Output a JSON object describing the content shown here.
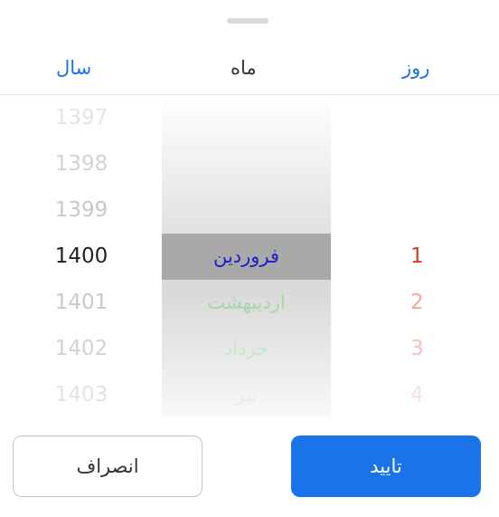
{
  "header": {
    "year_label": "سال",
    "month_label": "ماه",
    "day_label": "روز"
  },
  "years": [
    "1397",
    "1398",
    "1399",
    "1400",
    "1401",
    "1402",
    "1403"
  ],
  "months": [
    {
      "label": "فروردین",
      "row": 3,
      "color": "#2020c8"
    },
    {
      "label": "اردیبهشت",
      "row": 4,
      "color": "#a8d6a8"
    },
    {
      "label": "خرداد",
      "row": 5,
      "color": "#c8e6c8"
    },
    {
      "label": "تیر",
      "row": 6,
      "color": "#e3f0e3"
    }
  ],
  "days": [
    {
      "label": "1",
      "row": 3,
      "color": "#d83a2a"
    },
    {
      "label": "2",
      "row": 4,
      "color": "#f0a89e"
    },
    {
      "label": "3",
      "row": 5,
      "color": "#f4c2b9"
    },
    {
      "label": "4",
      "row": 6,
      "color": "#f9e1dc"
    }
  ],
  "year_colors": [
    "#e3e3e3",
    "#d3d3d3",
    "#c9c9c9",
    "#222222",
    "#c9c9c9",
    "#d3d3d3",
    "#e3e3e3"
  ],
  "buttons": {
    "cancel_label": "انصراف",
    "confirm_label": "تایید"
  },
  "colors": {
    "accent": "#1a73e8"
  }
}
